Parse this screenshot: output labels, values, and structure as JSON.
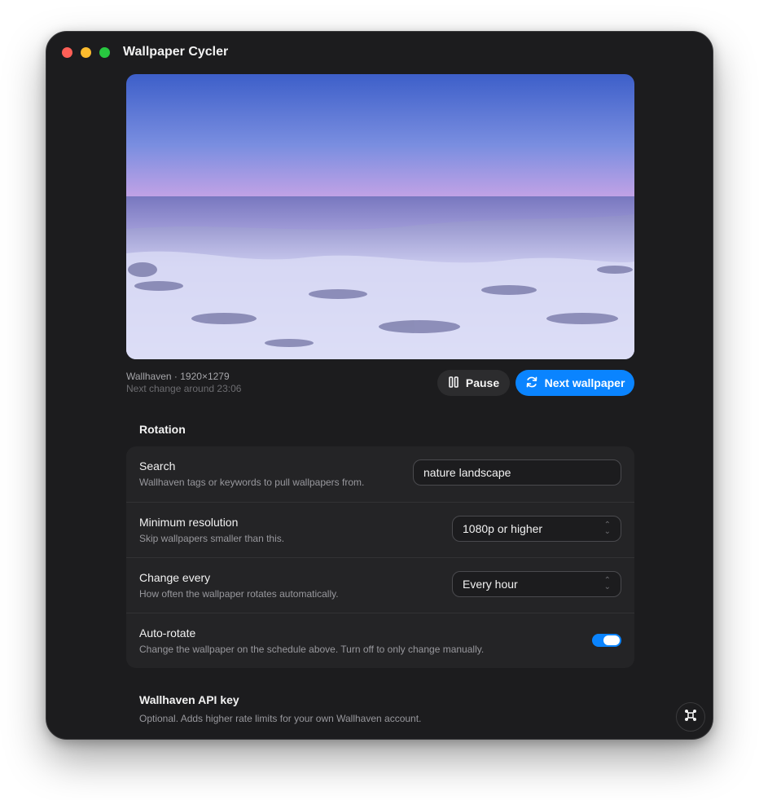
{
  "window": {
    "title": "Wallpaper Cycler"
  },
  "preview": {
    "source_info": "Wallhaven · 1920×1279",
    "next_change": "Next change around 23:06"
  },
  "actions": {
    "pause_label": "Pause",
    "next_label": "Next wallpaper"
  },
  "rotation": {
    "section_title": "Rotation",
    "search": {
      "label": "Search",
      "description": "Wallhaven tags or keywords to pull wallpapers from.",
      "value": "nature landscape"
    },
    "min_resolution": {
      "label": "Minimum resolution",
      "description": "Skip wallpapers smaller than this.",
      "selected": "1080p or higher"
    },
    "change_every": {
      "label": "Change every",
      "description": "How often the wallpaper rotates automatically.",
      "selected": "Every hour"
    },
    "auto_rotate": {
      "label": "Auto-rotate",
      "description": "Change the wallpaper on the schedule above. Turn off to only change manually.",
      "enabled": true
    }
  },
  "api_key": {
    "title": "Wallhaven API key",
    "description": "Optional. Adds higher rate limits for your own Wallhaven account."
  },
  "colors": {
    "accent": "#0a84ff",
    "window_bg": "#1c1c1e",
    "card_bg": "#242426"
  },
  "icons": {
    "pause": "pause-icon",
    "next": "refresh-icon",
    "fab": "command-icon"
  }
}
